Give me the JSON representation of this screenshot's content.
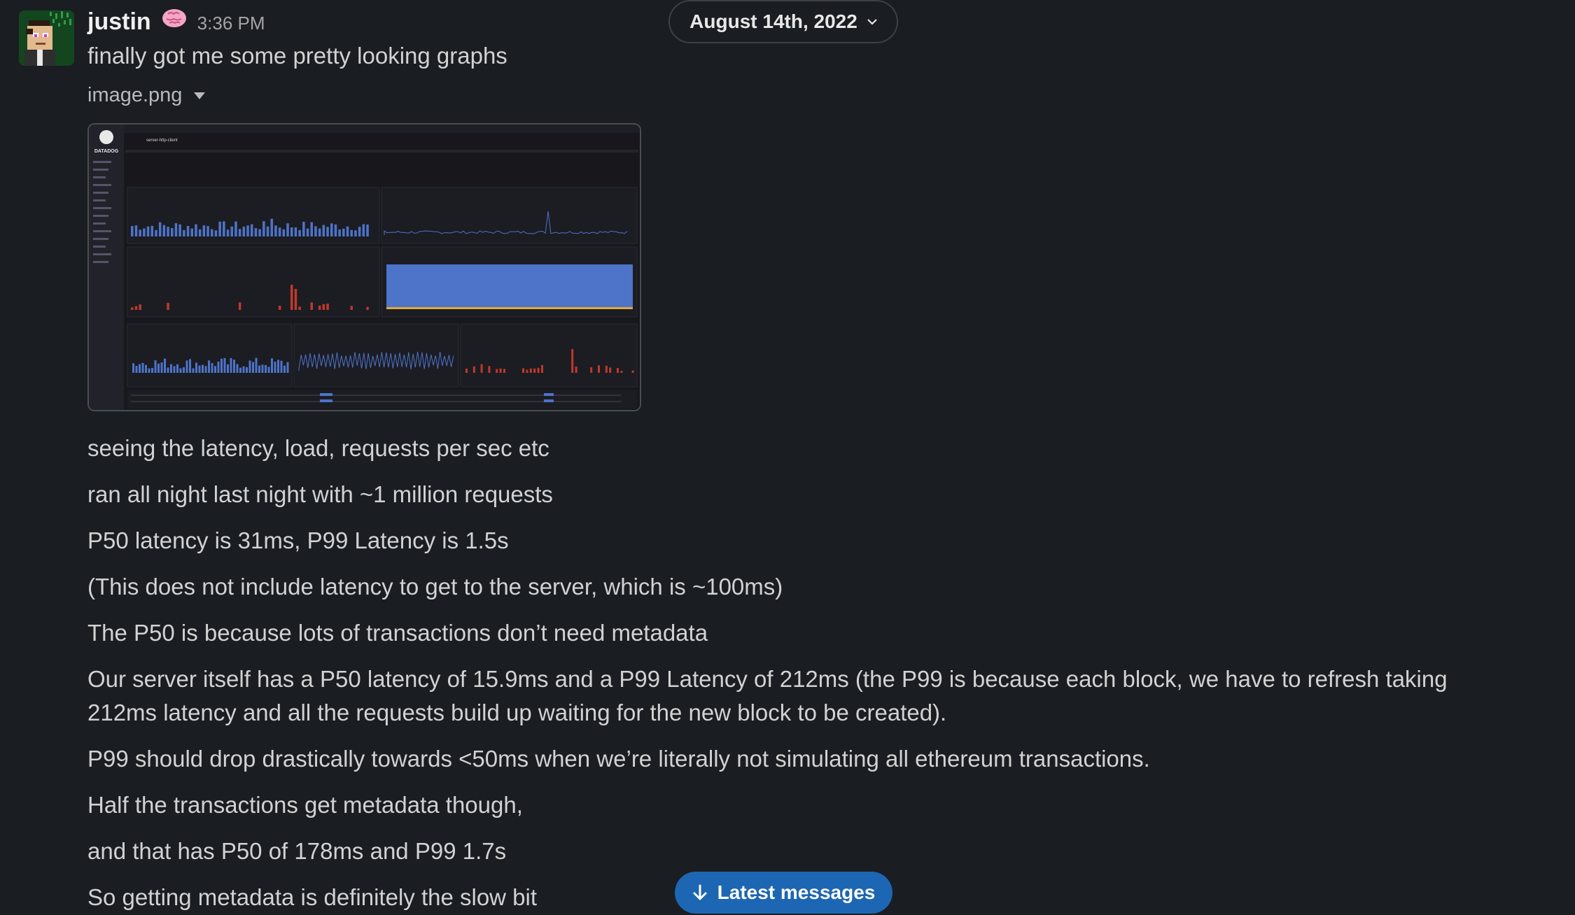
{
  "message": {
    "username": "justin",
    "status_emoji": "brain-emoji",
    "timestamp": "3:36 PM",
    "first_line": "finally got me some pretty looking graphs",
    "attachment": {
      "filename": "image.png",
      "thumbnail_icon": "dashboard-screenshot",
      "thumbnail_brand": "DATADOG",
      "thumbnail_service": "server-http-client"
    },
    "lines": [
      "seeing the latency, load, requests per sec etc",
      "ran all night last night with ~1 million requests",
      "P50 latency is 31ms, P99 Latency is 1.5s",
      "(This does not include latency to get to the server, which is ~100ms)",
      "The P50 is because lots of transactions don’t need metadata",
      "Our server itself has a P50 latency of 15.9ms and a P99 Latency of 212ms (the P99 is because each block, we have to refresh taking 212ms latency and all the requests build up waiting for the new block to be created).",
      "P99 should drop drastically towards <50ms when we’re literally not simulating all ethereum transactions.",
      "Half the transactions get metadata though,",
      "and that has P50 of 178ms and P99 1.7s",
      "So getting metadata is definitely the slow bit"
    ]
  },
  "date_divider": {
    "label": "August 14th, 2022",
    "icon": "chevron-down-icon"
  },
  "jump_button": {
    "label": "Latest messages",
    "icon": "arrow-down-icon"
  },
  "colors": {
    "background": "#1a1d21",
    "text": "#d1d2d3",
    "accent_button": "#1d66b3",
    "chart_blue": "#4d74c9",
    "chart_red": "#c0392b"
  }
}
